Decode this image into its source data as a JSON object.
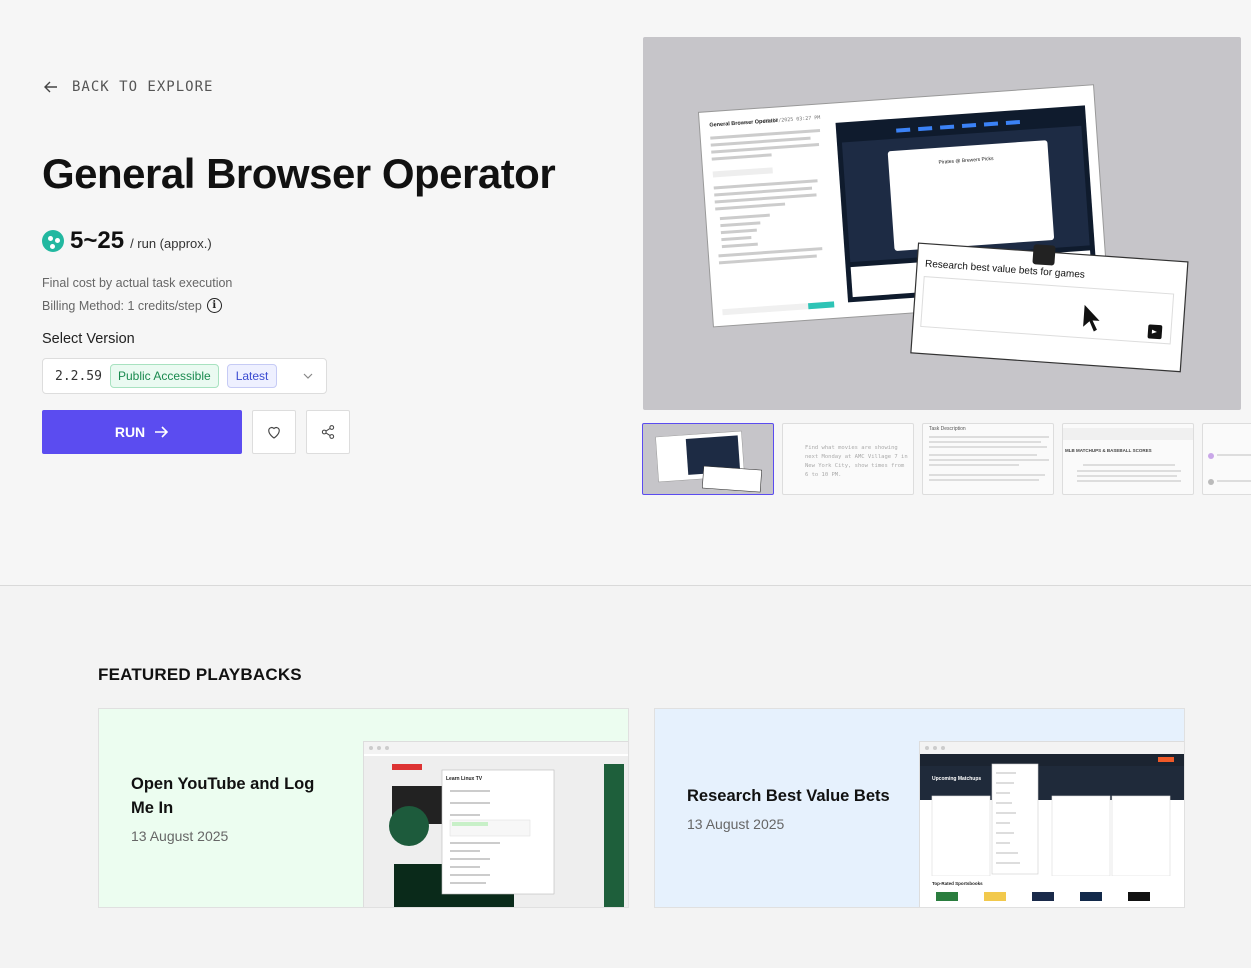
{
  "nav": {
    "back_label": "BACK TO EXPLORE"
  },
  "agent": {
    "title": "General Browser Operator",
    "price": "5~25",
    "price_unit": "/ run (approx.)",
    "cost_note": "Final cost by actual task execution",
    "billing": "Billing Method: 1 credits/step"
  },
  "version": {
    "label": "Select Version",
    "selected": "2.2.59",
    "badge_public": "Public Accessible",
    "badge_latest": "Latest"
  },
  "actions": {
    "run_label": "RUN"
  },
  "preview": {
    "main_window_title": "General Browser Operator",
    "main_window_date": "08/13/2025 03:27 PM",
    "overlay_prompt": "Research best value bets for games",
    "inner_heading": "Pirates @ Brewers Picks",
    "thumb2_text": "Find what movies are showing next Monday at AMC Village 7 in New York City, show times from 6 to 10 PM.",
    "thumb3_title": "Task Description",
    "thumb4_title": "MLB MATCHUPS & BASEBALL SCORES"
  },
  "featured": {
    "title": "FEATURED PLAYBACKS",
    "items": [
      {
        "title": "Open YouTube and Log Me In",
        "date": "13 August 2025",
        "shot_title": "Learn Linux TV"
      },
      {
        "title": "Research Best Value Bets",
        "date": "13 August 2025",
        "shot_title": "Upcoming Matchups",
        "shot_footer": "Top-Rated Sportsbooks"
      }
    ]
  },
  "colors": {
    "accent": "#5b4cf0",
    "coin": "#22b8a0",
    "badge_green": "#1a8a4f",
    "badge_blue": "#3b4bd1",
    "card_green_bg": "#ecfdf0",
    "card_blue_bg": "#e6f1fd"
  },
  "icons": [
    "arrow-left-icon",
    "coin-icon",
    "info-icon",
    "chevron-down-icon",
    "arrow-right-icon",
    "heart-icon",
    "share-icon"
  ]
}
